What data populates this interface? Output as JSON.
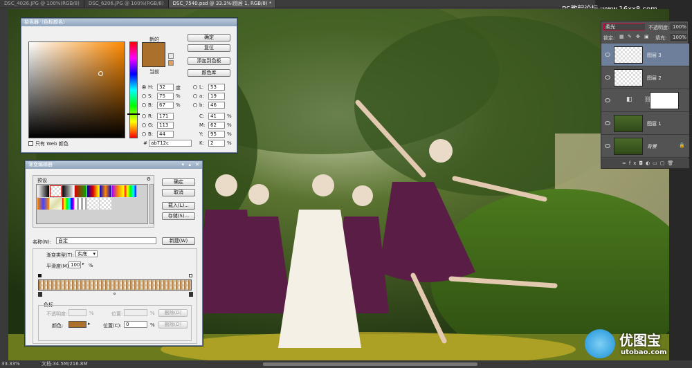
{
  "tabs": [
    {
      "label": "DSC_4026.JPG @ 100%(RGB/8)"
    },
    {
      "label": "DSC_6206.JPG @ 100%(RGB/8)"
    },
    {
      "label": "DSC_7540.psd @ 33.3%(图层 1, RGB/8) *"
    }
  ],
  "watermark": "PS教程论坛 www.16xx8.com",
  "color_picker": {
    "title": "拾色器（色标颜色）",
    "new_label": "新的",
    "current_label": "当前",
    "new_color": "#ab712c",
    "current_color": "#ab712c",
    "buttons": {
      "ok": "确定",
      "reset": "复位",
      "add_swatch": "添加到色板",
      "libraries": "颜色库"
    },
    "web_only": "只有 Web 颜色",
    "h_label": "H:",
    "h_value": "32",
    "h_unit": "度",
    "s_label": "S:",
    "s_value": "75",
    "s_unit": "%",
    "b_label": "B:",
    "b_value": "67",
    "b_unit": "%",
    "r_label": "R:",
    "r_value": "171",
    "g_label": "G:",
    "g_value": "113",
    "bl_label": "B:",
    "bl_value": "44",
    "l_label": "L:",
    "l_value": "53",
    "a_label": "a:",
    "a_value": "19",
    "lb_label": "b:",
    "lb_value": "46",
    "c_label": "C:",
    "c_value": "41",
    "c_unit": "%",
    "m_label": "M:",
    "m_value": "62",
    "m_unit": "%",
    "y_label": "Y:",
    "y_value": "95",
    "y_unit": "%",
    "k_label": "K:",
    "k_value": "2",
    "k_unit": "%",
    "hex_label": "#",
    "hex_value": "ab712c"
  },
  "gradient_editor": {
    "title": "渐变编辑器",
    "presets_label": "预设",
    "buttons": {
      "ok": "确定",
      "cancel": "取消",
      "load": "载入(L)...",
      "save": "存储(S)...",
      "new": "新建(W)"
    },
    "name_label": "名称(N):",
    "name_value": "自定",
    "type_label": "渐变类型(T):",
    "type_value": "实底",
    "smooth_label": "平滑度(M):",
    "smooth_value": "100",
    "smooth_unit": "%",
    "stops_group": "色标",
    "opacity_label": "不透明度:",
    "opacity_unit": "%",
    "location_label": "位置:",
    "location_unit": "%",
    "delete_label": "删除(D)",
    "color_label": "颜色:",
    "color_value": "#ab712c",
    "location2_label": "位置(C):",
    "location2_value": "0",
    "location2_unit": "%",
    "delete2_label": "删除(D)"
  },
  "layers_panel": {
    "blend_mode": "柔光",
    "opacity_label": "不透明度:",
    "opacity_value": "100%",
    "lock_label": "锁定:",
    "fill_label": "填充:",
    "fill_value": "100%",
    "layers": [
      {
        "name": "图层 3",
        "selected": true
      },
      {
        "name": "图层 2",
        "selected": false
      },
      {
        "name": "",
        "selected": false
      },
      {
        "name": "图层 1",
        "selected": false
      },
      {
        "name": "背景",
        "selected": false
      }
    ]
  },
  "status": {
    "zoom": "33.33%",
    "doc": "文档:34.5M/216.8M"
  },
  "logo": {
    "text": "优图宝",
    "url_text": "utobao.com"
  }
}
